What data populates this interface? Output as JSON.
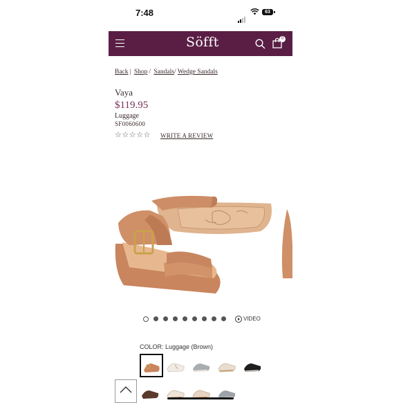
{
  "status_bar": {
    "time": "7:48",
    "battery": "63"
  },
  "header": {
    "logo": "Söfft",
    "menu_icon": "hamburger-icon",
    "search_icon": "search-icon",
    "cart_icon": "shopping-bag-icon",
    "cart_count": "0",
    "brand_color": "#5a1e45"
  },
  "breadcrumb": {
    "back": "Back",
    "items": [
      "Shop",
      "Sandals",
      "Wedge Sandals"
    ]
  },
  "product": {
    "name": "Vaya",
    "price": "$119.95",
    "color": "Luggage",
    "sku": "SF0060600",
    "rating_stars": "☆☆☆☆☆",
    "write_review": "WRITE A REVIEW"
  },
  "gallery": {
    "image_count": 9,
    "active_index": 0,
    "video_label": "VIDEO"
  },
  "color_selector": {
    "label": "COLOR: Luggage (Brown)",
    "swatches": [
      {
        "name": "Luggage (Brown)",
        "selected": true
      },
      {
        "name": "White",
        "selected": false
      },
      {
        "name": "Grey",
        "selected": false
      },
      {
        "name": "Ivory",
        "selected": false
      },
      {
        "name": "Black",
        "selected": false
      },
      {
        "name": "Dark Brown",
        "selected": false
      },
      {
        "name": "Cream",
        "selected": false
      },
      {
        "name": "Tan",
        "selected": false
      },
      {
        "name": "Light Grey",
        "selected": false
      }
    ]
  }
}
